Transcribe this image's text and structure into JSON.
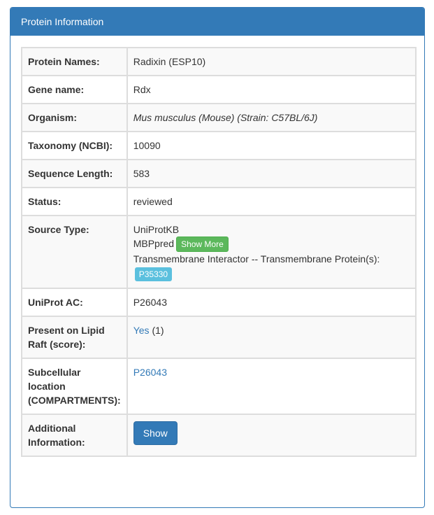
{
  "panel": {
    "title": "Protein Information"
  },
  "rows": {
    "protein_names": {
      "label": "Protein Names:",
      "value": "Radixin (ESP10)"
    },
    "gene_name": {
      "label": "Gene name:",
      "value": "Rdx"
    },
    "organism": {
      "label": "Organism:",
      "value": "Mus musculus (Mouse) (Strain: C57BL/6J)"
    },
    "taxonomy": {
      "label": "Taxonomy (NCBI):",
      "value": "10090"
    },
    "sequence_length": {
      "label": "Sequence Length:",
      "value": "583"
    },
    "status": {
      "label": "Status:",
      "value": "reviewed"
    },
    "source_type": {
      "label": "Source Type:",
      "line1": "UniProtKB",
      "line2": "MBPpred",
      "show_more_label": "Show More",
      "line3": "Transmembrane Interactor -- Transmembrane Protein(s):",
      "badge": "P35330"
    },
    "uniprot_ac": {
      "label": "UniProt AC:",
      "value": "P26043"
    },
    "lipid_raft": {
      "label": "Present on Lipid Raft (score):",
      "link": "Yes",
      "score": "(1)"
    },
    "subcellular": {
      "label": "Subcellular location (COMPARTMENTS):",
      "link": "P26043"
    },
    "additional": {
      "label": "Additional Information:",
      "button_label": "Show"
    }
  },
  "colors": {
    "primary": "#337ab7",
    "success": "#5cb85c",
    "info": "#5bc0de",
    "stripe": "#f9f9f9"
  }
}
